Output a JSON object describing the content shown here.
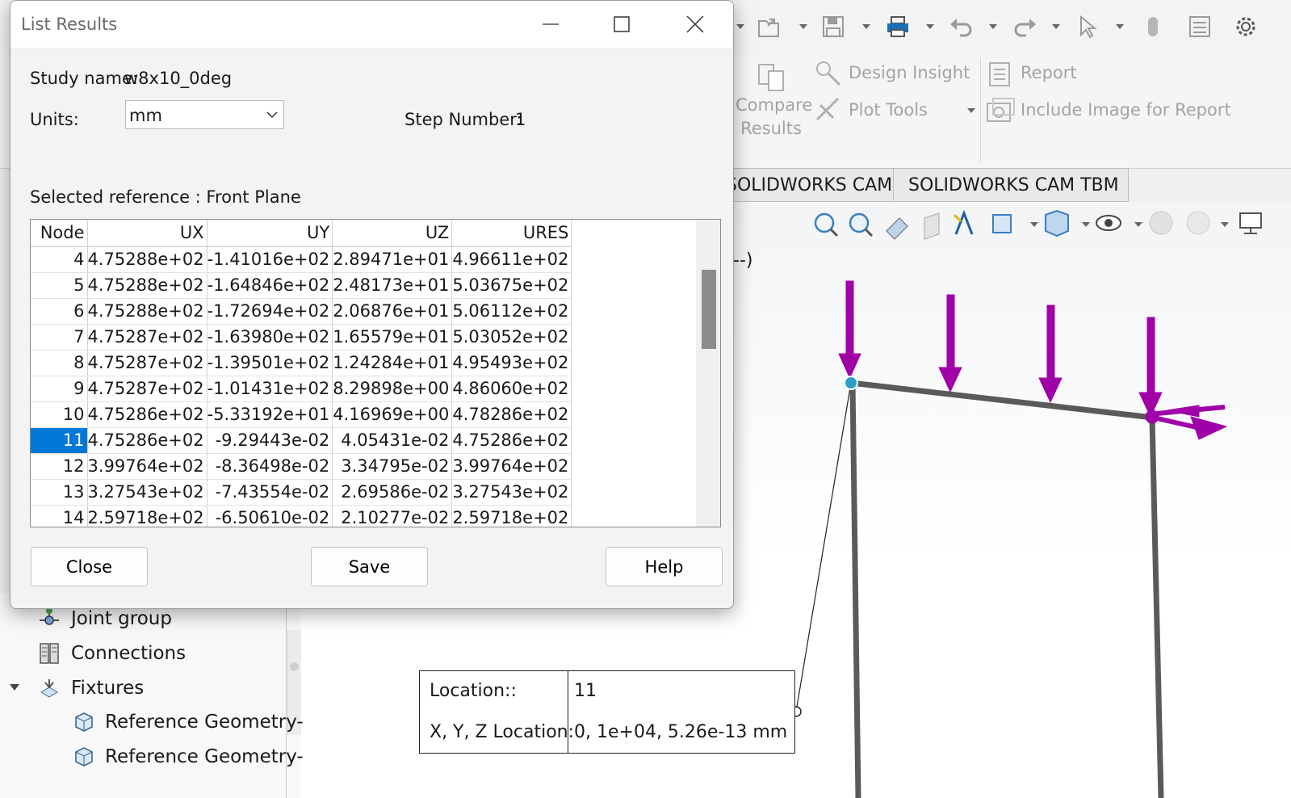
{
  "dialog": {
    "title": "List Results",
    "study_name_label": "Study name:",
    "study_name": "w8x10_0deg",
    "units_label": "Units:",
    "units_value": "mm",
    "step_label": "Step Number:",
    "step_value": "1",
    "selected_reference": "Selected reference : Front Plane",
    "table": {
      "columns": [
        "Node",
        "UX",
        "UY",
        "UZ",
        "URES"
      ],
      "rows": [
        [
          "4",
          "4.75288e+02",
          "-1.41016e+02",
          "2.89471e+01",
          "4.96611e+02"
        ],
        [
          "5",
          "4.75288e+02",
          "-1.64846e+02",
          "2.48173e+01",
          "5.03675e+02"
        ],
        [
          "6",
          "4.75288e+02",
          "-1.72694e+02",
          "2.06876e+01",
          "5.06112e+02"
        ],
        [
          "7",
          "4.75287e+02",
          "-1.63980e+02",
          "1.65579e+01",
          "5.03052e+02"
        ],
        [
          "8",
          "4.75287e+02",
          "-1.39501e+02",
          "1.24284e+01",
          "4.95493e+02"
        ],
        [
          "9",
          "4.75287e+02",
          "-1.01431e+02",
          "8.29898e+00",
          "4.86060e+02"
        ],
        [
          "10",
          "4.75286e+02",
          "-5.33192e+01",
          "4.16969e+00",
          "4.78286e+02"
        ],
        [
          "11",
          "4.75286e+02",
          "-9.29443e-02",
          "4.05431e-02",
          "4.75286e+02"
        ],
        [
          "12",
          "3.99764e+02",
          "-8.36498e-02",
          "3.34795e-02",
          "3.99764e+02"
        ],
        [
          "13",
          "3.27543e+02",
          "-7.43554e-02",
          "2.69586e-02",
          "3.27543e+02"
        ],
        [
          "14",
          "2.59718e+02",
          "-6.50610e-02",
          "2.10277e-02",
          "2.59718e+02"
        ]
      ],
      "selected_node": "11"
    },
    "buttons": {
      "close": "Close",
      "save": "Save",
      "help": "Help"
    }
  },
  "ribbon": {
    "compare_results": [
      "Compare",
      "Results"
    ],
    "design_insight": "Design Insight",
    "plot_tools": "Plot Tools",
    "report": "Report",
    "include_image": "Include Image for Report"
  },
  "tabs": [
    "SOLIDWORKS CAM",
    "SOLIDWORKS CAM TBM"
  ],
  "viewport": {
    "partial_label": "--)"
  },
  "tree": [
    {
      "label": "Joint group",
      "icon": "joint-group-icon"
    },
    {
      "label": "Connections",
      "icon": "connections-icon"
    },
    {
      "label": "Fixtures",
      "icon": "fixtures-icon"
    },
    {
      "label": "Reference Geometry-",
      "icon": "reference-geometry-icon"
    },
    {
      "label": "Reference Geometry-",
      "icon": "reference-geometry-icon"
    }
  ],
  "probe": {
    "location_label": "Location::",
    "location_value": "11",
    "xyz_label": "X, Y, Z Location:",
    "xyz_value": "0, 1e+04, 5.26e-13 mm"
  },
  "colors": {
    "selection": "#0078d7",
    "load_arrow": "#a000a8",
    "beam": "#5a5a5a",
    "node_marker": "#2aa0c8"
  }
}
